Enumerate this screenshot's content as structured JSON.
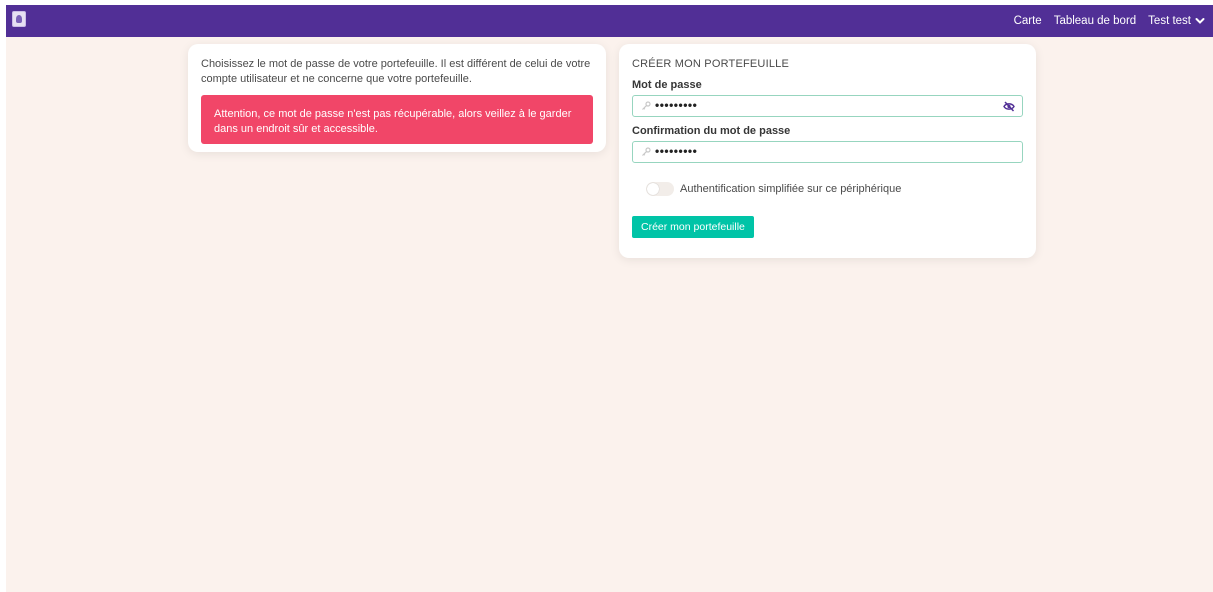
{
  "navbar": {
    "bg_color": "#512f96",
    "logo_icon": "app-logo-icon",
    "links": [
      "Carte",
      "Tableau de bord"
    ],
    "user": {
      "name": "Test test",
      "icon": "chevron-down-icon"
    }
  },
  "info_card": {
    "intro": "Choisissez le mot de passe de votre portefeuille. Il est différent de celui de votre compte utilisateur et ne concerne que votre portefeuille.",
    "warning": "Attention, ce mot de passe n'est pas récupérable, alors veillez à le garder dans un endroit sûr et accessible.",
    "warning_color": "#f14668"
  },
  "form": {
    "title": "CRÉER MON PORTEFEUILLE",
    "password": {
      "label": "Mot de passe",
      "value": "•••••••••",
      "icon": "key-icon",
      "toggle_icon": "eye-off-icon"
    },
    "confirm": {
      "label": "Confirmation du mot de passe",
      "value": "•••••••••",
      "icon": "key-icon"
    },
    "toggle": {
      "label": "Authentification simplifiée sur ce périphérique",
      "on": false
    },
    "submit_label": "Créer mon portefeuille",
    "submit_color": "#00c4a7"
  }
}
